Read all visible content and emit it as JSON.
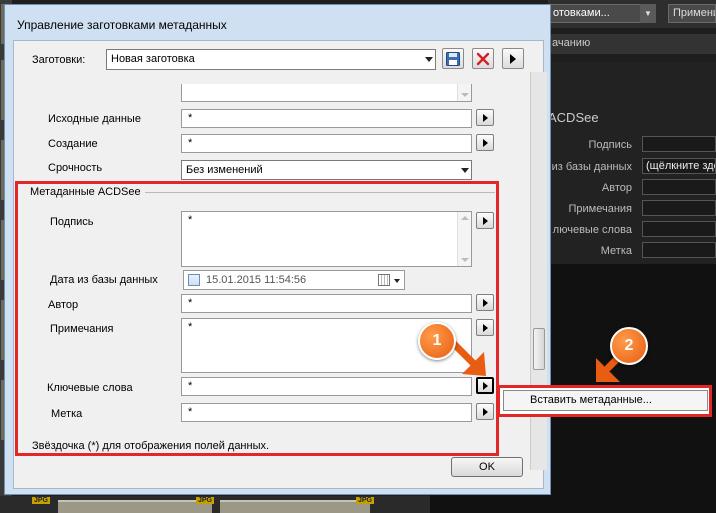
{
  "background": {
    "select_value": "отовками...",
    "apply_label": "Примени",
    "sort_header": "ачанию",
    "section_title": "ACDSee",
    "rows": [
      {
        "label": "Подпись",
        "value": ""
      },
      {
        "label": "из базы данных",
        "value": "(щёлкните зде"
      },
      {
        "label": "Автор",
        "value": ""
      },
      {
        "label": "Примечания",
        "value": ""
      },
      {
        "label": "лючевые слова",
        "value": ""
      },
      {
        "label": "Метка",
        "value": ""
      }
    ],
    "jpg_tags": [
      "JPG",
      "JPG",
      "JPG"
    ]
  },
  "dialog": {
    "title": "Управление заготовками метаданных",
    "presets_label": "Заготовки:",
    "preset_value": "Новая заготовка",
    "save_icon": "floppy-disk-icon",
    "delete_icon": "red-x-icon",
    "fields_top": [
      {
        "label": "Исходные данные",
        "value": "*"
      },
      {
        "label": "Создание",
        "value": "*"
      }
    ],
    "urgency": {
      "label": "Срочность",
      "value": "Без изменений"
    },
    "acdsee_section": "Метаданные ACDSee",
    "caption": {
      "label": "Подпись",
      "value": "*"
    },
    "db_date": {
      "label": "Дата из базы данных",
      "value": "15.01.2015 11:54:56"
    },
    "author": {
      "label": "Автор",
      "value": "*"
    },
    "notes": {
      "label": "Примечания",
      "value": "*"
    },
    "keywords": {
      "label": "Ключевые слова",
      "value": "*"
    },
    "label": {
      "label": "Метка",
      "value": "*"
    },
    "hint": "Звёздочка (*) для отображения полей данных.",
    "ok_label": "OK"
  },
  "context_menu": {
    "insert_metadata": "Вставить метаданные..."
  },
  "annotations": {
    "badge1": "1",
    "badge2": "2",
    "color": "#e32727",
    "badge_color": "#e85d12"
  }
}
